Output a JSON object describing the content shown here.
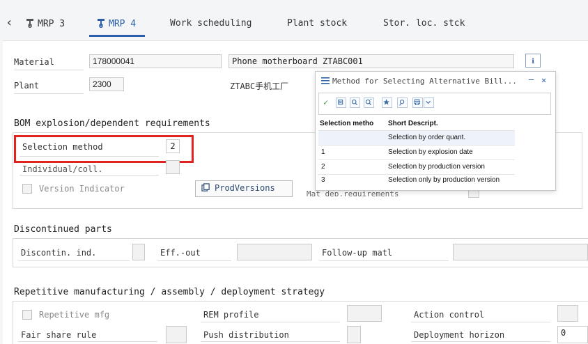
{
  "tabs": [
    {
      "label": "MRP 3"
    },
    {
      "label": "MRP 4"
    },
    {
      "label": "Work scheduling"
    },
    {
      "label": "Plant stock"
    },
    {
      "label": "Stor. loc. stck"
    }
  ],
  "header": {
    "material_label": "Material",
    "material_value": "178000041",
    "material_desc": "Phone motherboard ZTABC001",
    "plant_label": "Plant",
    "plant_value": "2300",
    "plant_desc": "ZTABC手机工厂",
    "info_icon": "i"
  },
  "bom": {
    "title": "BOM explosion/dependent requirements",
    "selection_method_label": "Selection method",
    "selection_method_value": "2",
    "individual_coll_label": "Individual/coll.",
    "version_indicator_label": "Version Indicator",
    "prodversions_button": "ProdVersions",
    "hidden_label": "Mat dep.requirements"
  },
  "discontinued": {
    "title": "Discontinued parts",
    "discontin_label": "Discontin. ind.",
    "eff_out_label": "Eff.-out",
    "followup_label": "Follow-up matl"
  },
  "repetitive": {
    "title": "Repetitive manufacturing / assembly / deployment strategy",
    "repetitive_mfg_label": "Repetitive mfg",
    "rem_profile_label": "REM profile",
    "action_control_label": "Action control",
    "fair_share_label": "Fair share rule",
    "push_distribution_label": "Push distribution",
    "deployment_horizon_label": "Deployment horizon",
    "deployment_horizon_value": "0"
  },
  "popup": {
    "title": "Method for Selecting Alternative Bill...",
    "minimize": "—",
    "close": "✕",
    "col_method": "Selection metho",
    "col_desc": "Short Descript.",
    "rows": [
      {
        "method": "",
        "desc": "Selection by order quant."
      },
      {
        "method": "1",
        "desc": "Selection by explosion date"
      },
      {
        "method": "2",
        "desc": "Selection by production version"
      },
      {
        "method": "3",
        "desc": "Selection only by production version"
      }
    ]
  },
  "colors": {
    "accent": "#2a5fa8",
    "highlight_border": "#e0231e",
    "selected_row": "#eef3fb"
  },
  "icons": [
    "back-chevron-icon",
    "material-master-icon",
    "info-icon",
    "menu-icon",
    "minimize-icon",
    "close-icon",
    "check-icon",
    "filter-icon",
    "search-icon",
    "search-more-icon",
    "favorite-icon",
    "help-icon",
    "print-icon",
    "chevron-down-icon",
    "prodversions-icon"
  ]
}
